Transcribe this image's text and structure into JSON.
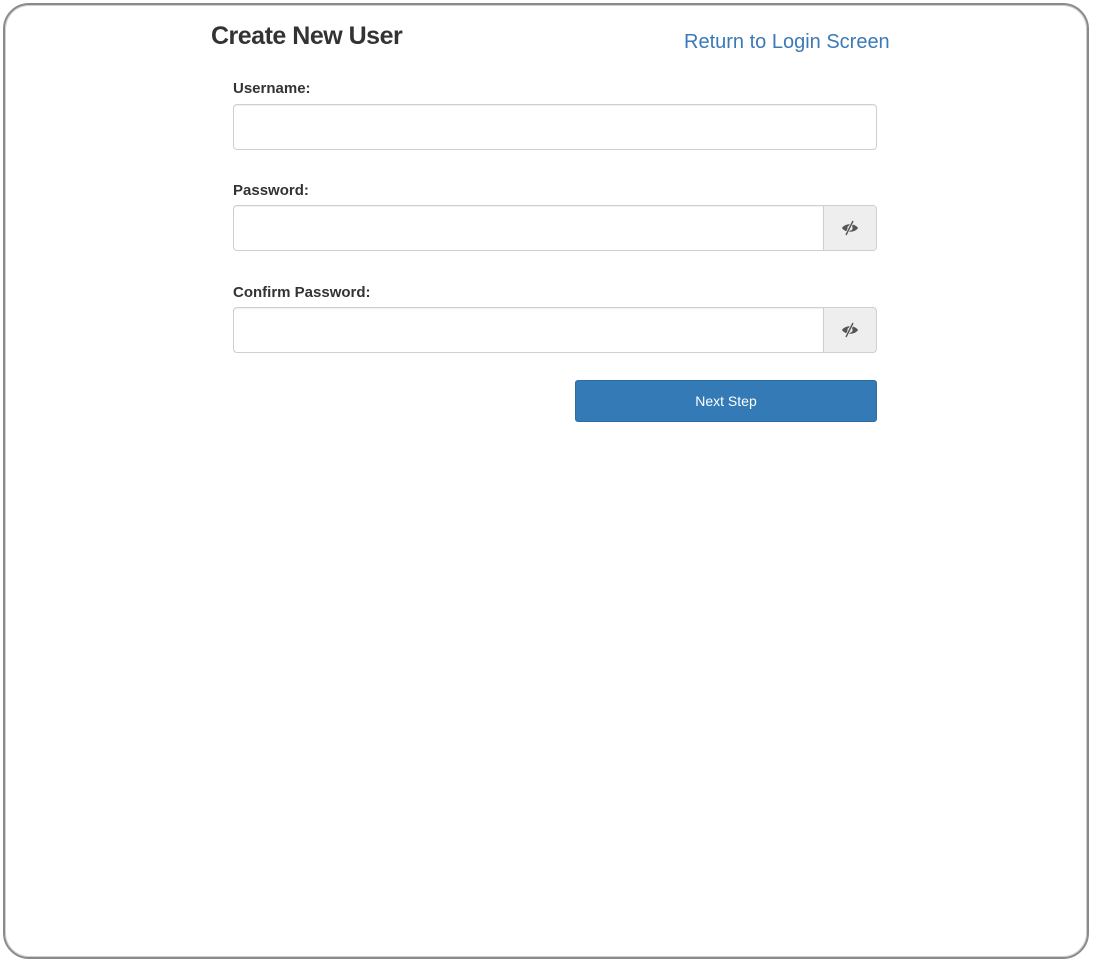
{
  "header": {
    "title": "Create New User",
    "return_link": "Return to Login Screen"
  },
  "form": {
    "username": {
      "label": "Username:",
      "value": "",
      "placeholder": ""
    },
    "password": {
      "label": "Password:",
      "value": "",
      "placeholder": "",
      "toggle_icon": "eye-slash-icon"
    },
    "confirm_password": {
      "label": "Confirm Password:",
      "value": "",
      "placeholder": "",
      "toggle_icon": "eye-slash-icon"
    },
    "submit_label": "Next Step"
  },
  "colors": {
    "accent": "#337ab7",
    "link": "#3a7ab8",
    "text": "#333333"
  }
}
